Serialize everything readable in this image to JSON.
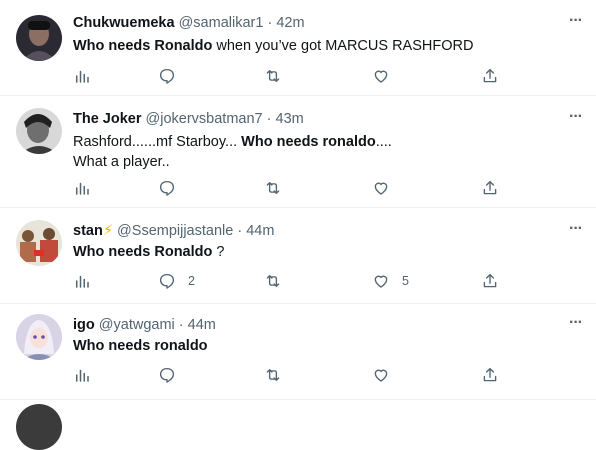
{
  "tweets": [
    {
      "name": "Chukwuemeka",
      "badge": "",
      "handle": "@samalikar1",
      "sep": "·",
      "time": "42m",
      "line1": [
        {
          "b": true,
          "t": "Who needs Ronaldo"
        },
        {
          "b": false,
          "t": " when you’ve got MARCUS RASHFORD"
        }
      ],
      "line2": "",
      "replies": "",
      "likes": ""
    },
    {
      "name": "The Joker",
      "badge": "",
      "handle": "@jokervsbatman7",
      "sep": "·",
      "time": "43m",
      "line1": [
        {
          "b": false,
          "t": "Rashford......mf Starboy... "
        },
        {
          "b": true,
          "t": "Who needs ronaldo"
        },
        {
          "b": false,
          "t": "...."
        }
      ],
      "line2": "What a player..",
      "replies": "",
      "likes": ""
    },
    {
      "name": "stan",
      "badge": "⚡",
      "handle": "@Ssempijjastanle",
      "sep": "·",
      "time": "44m",
      "line1": [
        {
          "b": true,
          "t": "Who needs Ronaldo"
        },
        {
          "b": false,
          "t": " ?"
        }
      ],
      "line2": "",
      "replies": "2",
      "likes": "5"
    },
    {
      "name": "igo",
      "badge": "",
      "handle": "@yatwgami",
      "sep": "·",
      "time": "44m",
      "line1": [
        {
          "b": true,
          "t": "Who needs ronaldo"
        }
      ],
      "line2": "",
      "replies": "",
      "likes": ""
    }
  ],
  "icons": {
    "more": "more-icon",
    "analytics": "analytics-icon",
    "reply": "reply-icon",
    "retweet": "retweet-icon",
    "like": "like-icon",
    "share": "share-icon"
  },
  "colors": {
    "text": "#0f1419",
    "muted": "#536471",
    "divider": "#eff3f4",
    "bolt": "#f4b400"
  }
}
